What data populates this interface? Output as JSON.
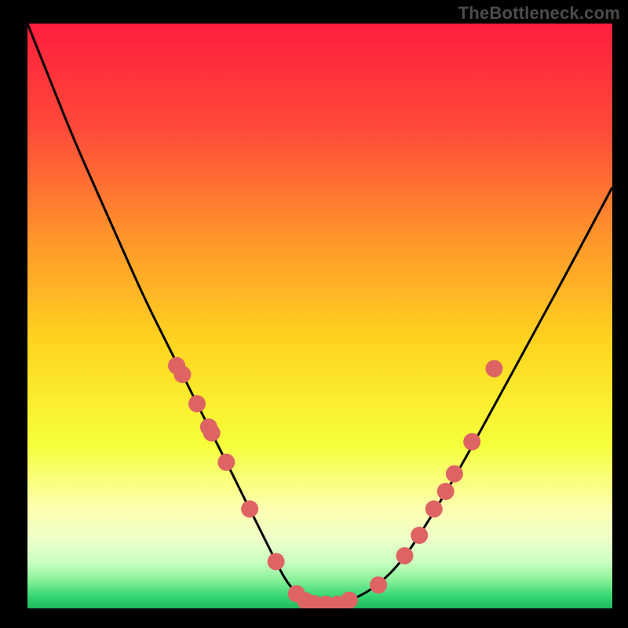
{
  "watermark": "TheBottleneck.com",
  "chart_data": {
    "type": "line",
    "title": "",
    "xlabel": "",
    "ylabel": "",
    "xlim": [
      0,
      100
    ],
    "ylim": [
      0,
      100
    ],
    "grid": false,
    "legend": false,
    "series": [
      {
        "name": "curve",
        "x": [
          0,
          4,
          8,
          12,
          16,
          20,
          24,
          28,
          32,
          34,
          36,
          38,
          40,
          42,
          44,
          46,
          48,
          50,
          52,
          56,
          60,
          64,
          68,
          74,
          80,
          86,
          92,
          100
        ],
        "y": [
          100,
          90,
          80,
          71,
          62,
          53,
          45,
          37,
          29,
          25,
          21,
          17,
          13,
          9,
          5,
          2.5,
          1.2,
          0.7,
          0.7,
          1.6,
          4,
          8,
          14,
          24,
          35,
          46,
          57,
          72
        ]
      }
    ],
    "markers": [
      {
        "x": 25.5,
        "y": 41.5
      },
      {
        "x": 26.5,
        "y": 40.0
      },
      {
        "x": 29.0,
        "y": 35.0
      },
      {
        "x": 31.0,
        "y": 31.0
      },
      {
        "x": 31.5,
        "y": 30.0
      },
      {
        "x": 34.0,
        "y": 25.0
      },
      {
        "x": 38.0,
        "y": 17.0
      },
      {
        "x": 42.5,
        "y": 8.0
      },
      {
        "x": 46.0,
        "y": 2.5
      },
      {
        "x": 47.5,
        "y": 1.3
      },
      {
        "x": 49.0,
        "y": 0.8
      },
      {
        "x": 51.0,
        "y": 0.7
      },
      {
        "x": 53.0,
        "y": 0.7
      },
      {
        "x": 55.0,
        "y": 1.4
      },
      {
        "x": 60.0,
        "y": 4.0
      },
      {
        "x": 64.5,
        "y": 9.0
      },
      {
        "x": 67.0,
        "y": 12.5
      },
      {
        "x": 69.5,
        "y": 17.0
      },
      {
        "x": 71.5,
        "y": 20.0
      },
      {
        "x": 73.0,
        "y": 23.0
      },
      {
        "x": 76.0,
        "y": 28.5
      },
      {
        "x": 79.8,
        "y": 41.0
      }
    ],
    "gradient_stops": [
      {
        "offset": 0,
        "color": "#ff1e3c"
      },
      {
        "offset": 18,
        "color": "#ff4a3a"
      },
      {
        "offset": 38,
        "color": "#ff9a2a"
      },
      {
        "offset": 55,
        "color": "#ffd61f"
      },
      {
        "offset": 72,
        "color": "#f6ff3a"
      },
      {
        "offset": 83,
        "color": "#fcffb0"
      },
      {
        "offset": 88,
        "color": "#eeffc8"
      },
      {
        "offset": 92,
        "color": "#ccffc2"
      },
      {
        "offset": 95,
        "color": "#8cf29a"
      },
      {
        "offset": 98,
        "color": "#34d672"
      },
      {
        "offset": 100,
        "color": "#1fb85e"
      }
    ],
    "marker_color": "#de6464",
    "marker_radius": 11
  }
}
